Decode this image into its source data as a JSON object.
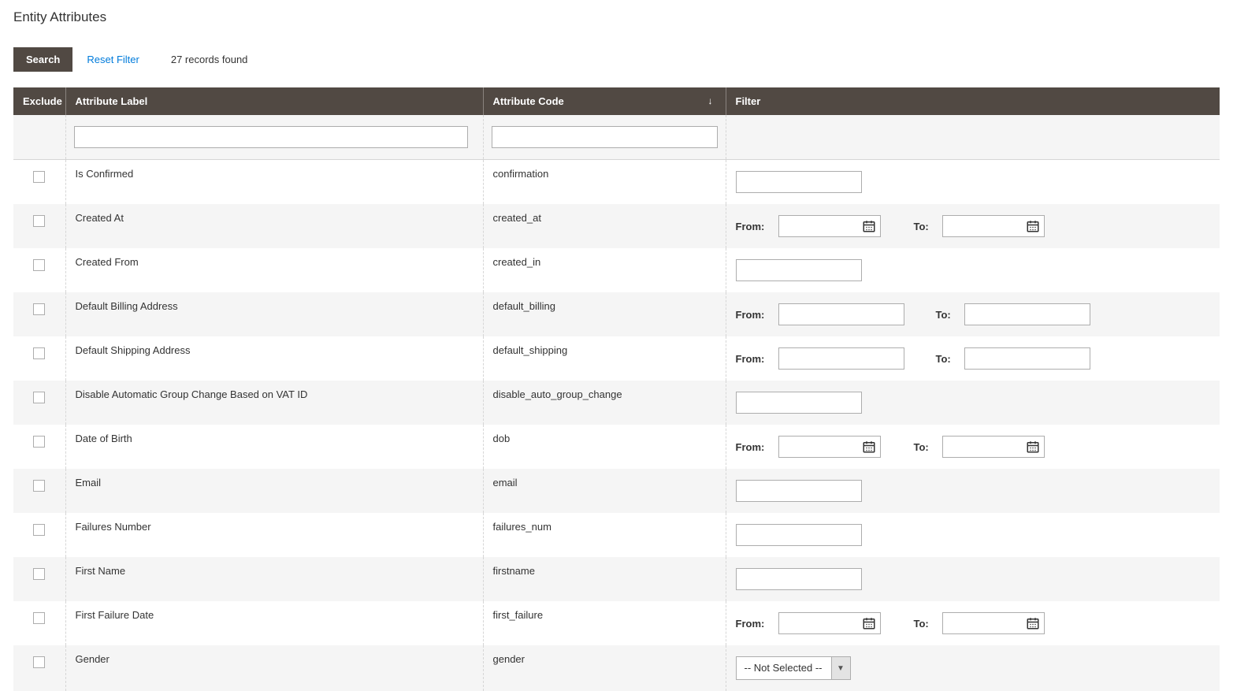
{
  "page_title": "Entity Attributes",
  "toolbar": {
    "search_label": "Search",
    "reset_label": "Reset Filter",
    "records_found": "27 records found"
  },
  "headers": {
    "exclude": "Exclude",
    "label": "Attribute Label",
    "code": "Attribute Code",
    "filter": "Filter"
  },
  "labels": {
    "from": "From:",
    "to": "To:",
    "not_selected": "-- Not Selected --"
  },
  "rows": [
    {
      "label": "Is Confirmed",
      "code": "confirmation",
      "filter_type": "text"
    },
    {
      "label": "Created At",
      "code": "created_at",
      "filter_type": "daterange"
    },
    {
      "label": "Created From",
      "code": "created_in",
      "filter_type": "text"
    },
    {
      "label": "Default Billing Address",
      "code": "default_billing",
      "filter_type": "range"
    },
    {
      "label": "Default Shipping Address",
      "code": "default_shipping",
      "filter_type": "range"
    },
    {
      "label": "Disable Automatic Group Change Based on VAT ID",
      "code": "disable_auto_group_change",
      "filter_type": "text"
    },
    {
      "label": "Date of Birth",
      "code": "dob",
      "filter_type": "daterange"
    },
    {
      "label": "Email",
      "code": "email",
      "filter_type": "text"
    },
    {
      "label": "Failures Number",
      "code": "failures_num",
      "filter_type": "text"
    },
    {
      "label": "First Name",
      "code": "firstname",
      "filter_type": "text"
    },
    {
      "label": "First Failure Date",
      "code": "first_failure",
      "filter_type": "daterange"
    },
    {
      "label": "Gender",
      "code": "gender",
      "filter_type": "select"
    }
  ]
}
